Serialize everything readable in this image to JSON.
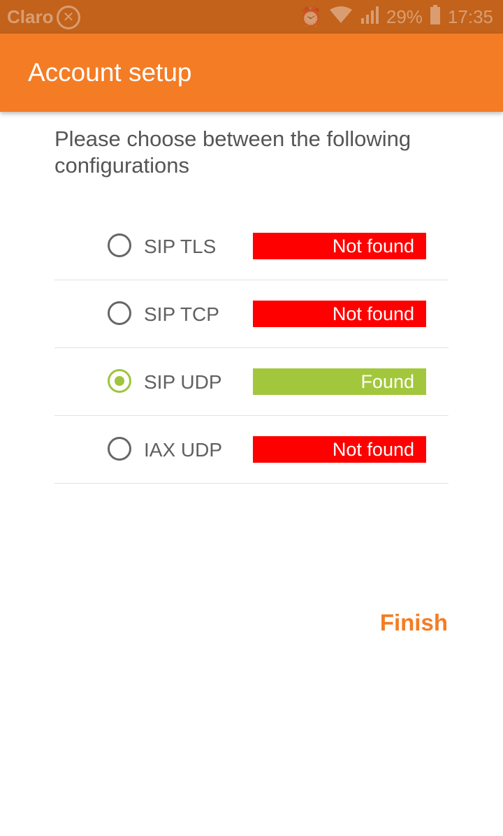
{
  "status_bar": {
    "carrier": "Claro",
    "battery": "29%",
    "time": "17:35",
    "icons": [
      "x-circle-icon",
      "alarm-icon",
      "wifi-icon",
      "signal-icon",
      "battery-icon"
    ]
  },
  "app_bar": {
    "title": "Account setup"
  },
  "intro": "Please choose between the following configurations",
  "options": [
    {
      "label": "SIP TLS",
      "status": "Not found",
      "status_color": "#ff0000",
      "selected": false
    },
    {
      "label": "SIP TCP",
      "status": "Not found",
      "status_color": "#ff0000",
      "selected": false
    },
    {
      "label": "SIP UDP",
      "status": "Found",
      "status_color": "#a3c73c",
      "selected": true
    },
    {
      "label": "IAX UDP",
      "status": "Not found",
      "status_color": "#ff0000",
      "selected": false
    }
  ],
  "finish_label": "Finish",
  "colors": {
    "accent": "#f47c24",
    "status_bar": "#c2621b",
    "selected": "#9ec53c"
  }
}
